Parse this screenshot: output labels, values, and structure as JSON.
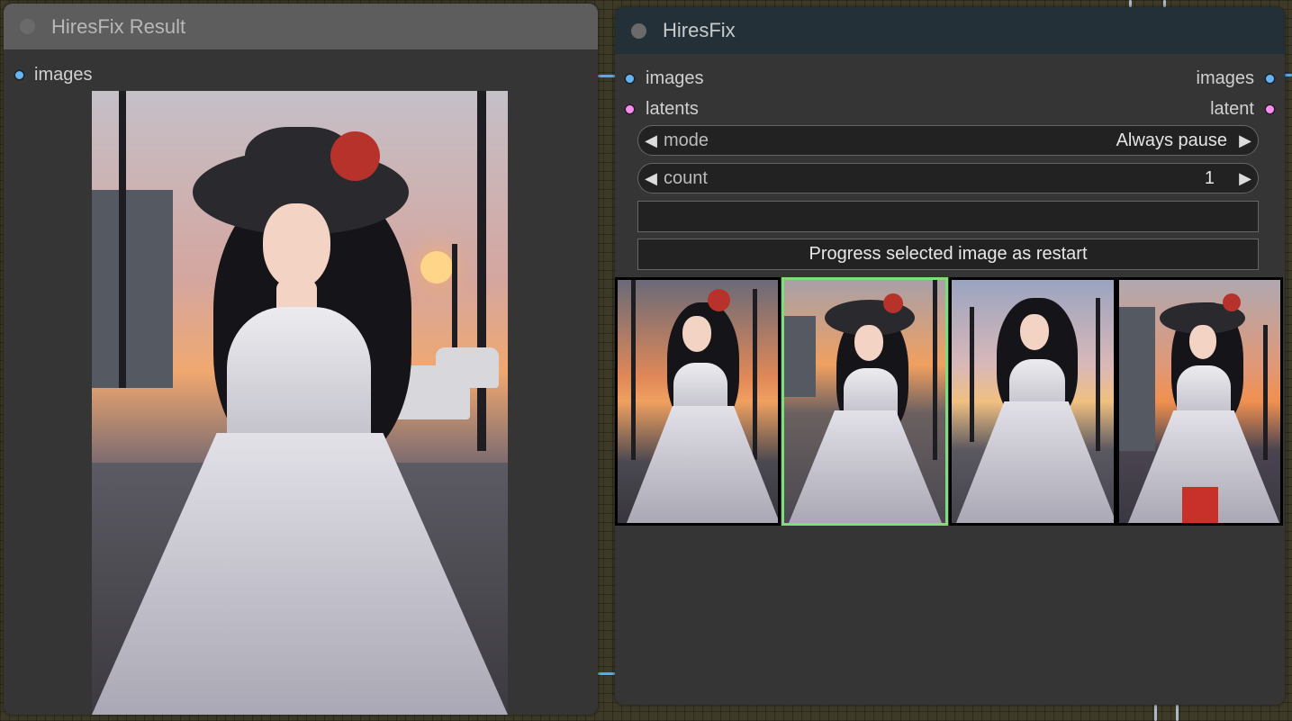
{
  "result_node": {
    "title": "HiresFix Result",
    "input_label": "images",
    "image_alt": "generated anime girl in white dress with black hat"
  },
  "hires_node": {
    "title": "HiresFix",
    "inputs": [
      {
        "label": "images",
        "color": "#64b5f6"
      },
      {
        "label": "latents",
        "color": "#ff8cf0"
      }
    ],
    "outputs": [
      {
        "label": "images",
        "color": "#64b5f6"
      },
      {
        "label": "latent",
        "color": "#ff8cf0"
      }
    ],
    "mode": {
      "label": "mode",
      "value": "Always pause"
    },
    "count": {
      "label": "count",
      "value": "1"
    },
    "text_value": "",
    "button_label": "Progress selected image as restart",
    "thumbnails": [
      {
        "selected": false
      },
      {
        "selected": true
      },
      {
        "selected": false
      },
      {
        "selected": false
      }
    ]
  },
  "icons": {
    "left_arrow": "triangle-left-icon",
    "right_arrow": "triangle-right-icon"
  },
  "colors": {
    "selection": "#7be07b",
    "image_slot": "#64b5f6",
    "latent_slot": "#ff8cf0"
  }
}
